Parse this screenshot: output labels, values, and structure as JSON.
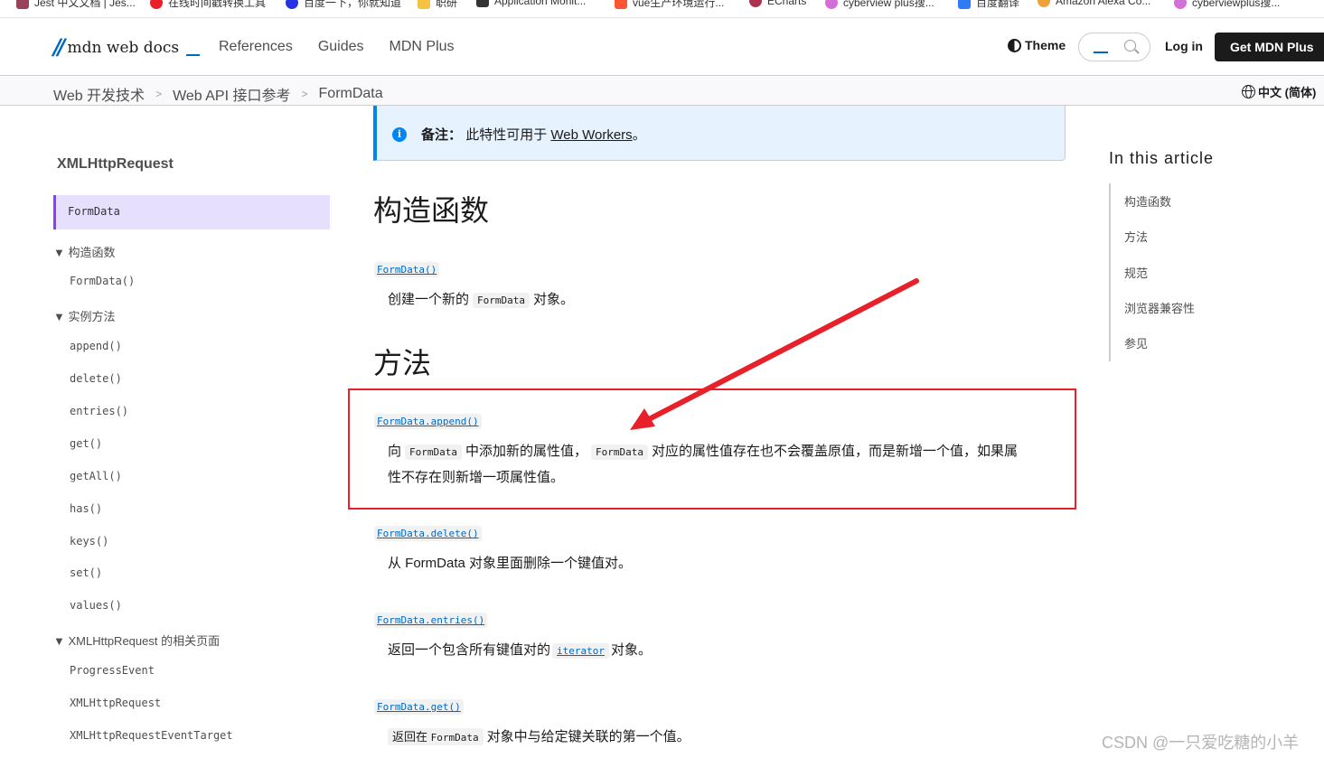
{
  "bookmarks": [
    {
      "label": "Jest 中文文档 | Jes...",
      "icon": "jest-icon",
      "color": "#99425b"
    },
    {
      "label": "在线时间戳转换工具",
      "icon": "clock-icon",
      "color": "#e8202a"
    },
    {
      "label": "百度一下，你就知道",
      "icon": "baidu-paw-icon",
      "color": "#2932e1"
    },
    {
      "label": "职研",
      "icon": "folder-icon",
      "color": "#f5c242"
    },
    {
      "label": "Application Monit...",
      "icon": "monitor-icon",
      "color": "#333333"
    },
    {
      "label": "vue生产环境运行...",
      "icon": "csdn-icon",
      "color": "#fc5531"
    },
    {
      "label": "ECharts",
      "icon": "echarts-icon",
      "color": "#aa344d"
    },
    {
      "label": "cyberview plus搜...",
      "icon": "cyberview-icon",
      "color": "#d46fd8"
    },
    {
      "label": "百度翻译",
      "icon": "translate-icon",
      "color": "#2f7bf5"
    },
    {
      "label": "Amazon Alexa Co...",
      "icon": "alexa-icon",
      "color": "#f0a23a"
    },
    {
      "label": "cyberviewplus搜...",
      "icon": "cyberview-icon",
      "color": "#d46fd8"
    }
  ],
  "header": {
    "logo_text": "mdn web docs",
    "nav": [
      "References",
      "Guides",
      "MDN Plus"
    ],
    "theme_label": "Theme",
    "login_label": "Log in",
    "get_plus_label": "Get MDN Plus",
    "accent": "#0069c2"
  },
  "breadcrumb": {
    "items": [
      "Web 开发技术",
      "Web API 接口参考",
      "FormData"
    ],
    "language": "中文 (简体)"
  },
  "sidebar": {
    "title": "XMLHttpRequest",
    "active": "FormData",
    "groups": [
      {
        "label": "构造函数",
        "items": [
          "FormData()"
        ]
      },
      {
        "label": "实例方法",
        "items": [
          "append()",
          "delete()",
          "entries()",
          "get()",
          "getAll()",
          "has()",
          "keys()",
          "set()",
          "values()"
        ]
      },
      {
        "label": "XMLHttpRequest 的相关页面",
        "items": [
          "ProgressEvent",
          "XMLHttpRequest",
          "XMLHttpRequestEventTarget"
        ]
      }
    ]
  },
  "note": {
    "label": "备注：",
    "text": "此特性可用于",
    "link": "Web Workers",
    "suffix": "。"
  },
  "sections": {
    "constructors_heading": "构造函数",
    "constructor": {
      "term": "FormData()",
      "pre": "创建一个新的",
      "code": "FormData",
      "post": "对象。"
    },
    "methods_heading": "方法",
    "append": {
      "term": "FormData.append()",
      "p1": "向",
      "code1": "FormData",
      "p2": "中添加新的属性值，",
      "code2": "FormData",
      "p3": "对应的属性值存在也不会覆盖原值，而是新增一个值，如果属",
      "line2": "性不存在则新增一项属性值。"
    },
    "delete": {
      "term": "FormData.delete()",
      "desc": "从 FormData 对象里面删除一个键值对。"
    },
    "entries": {
      "term": "FormData.entries()",
      "pre": "返回一个包含所有键值对的",
      "code": "iterator",
      "post": "对象。"
    },
    "get": {
      "term": "FormData.get()",
      "code_pre": "返回在",
      "code": "FormData",
      "post": "对象中与给定键关联的第一个值。"
    }
  },
  "toc": {
    "title": "In this article",
    "items": [
      "构造函数",
      "方法",
      "规范",
      "浏览器兼容性",
      "参见"
    ]
  },
  "annotation": {
    "color": "#e8202a"
  },
  "watermark": "CSDN @一只爱吃糖的小羊"
}
